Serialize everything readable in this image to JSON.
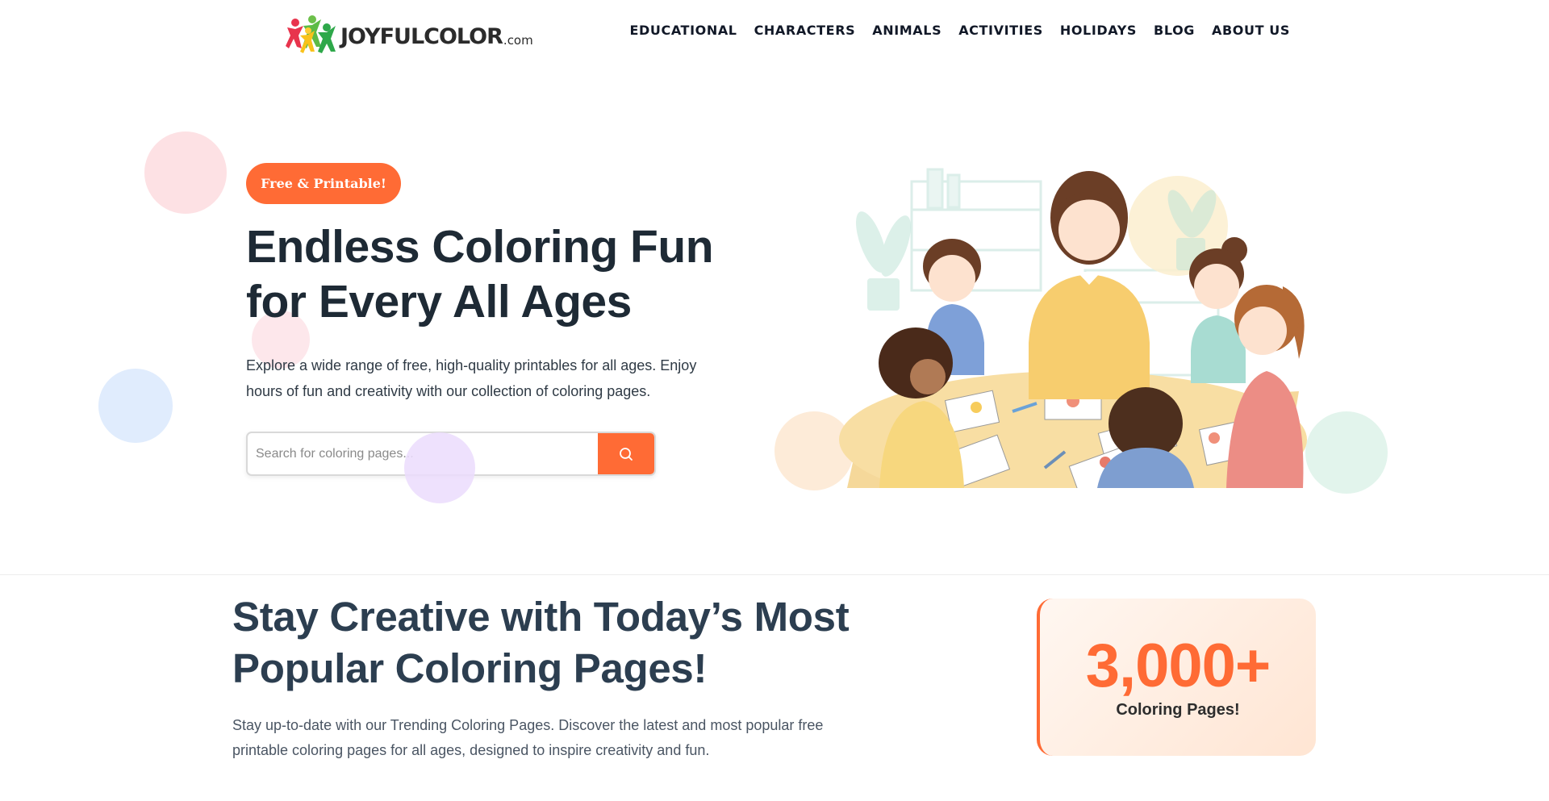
{
  "header": {
    "logo_text": "JOYFULCOLOR",
    "logo_tld": ".com",
    "nav": [
      "EDUCATIONAL",
      "CHARACTERS",
      "ANIMALS",
      "ACTIVITIES",
      "HOLIDAYS",
      "BLOG",
      "ABOUT US"
    ]
  },
  "hero": {
    "badge": "Free & Printable!",
    "title": "Endless Coloring Fun for Every All Ages",
    "description": "Explore a wide range of free, high-quality printables for all ages. Enjoy hours of fun and creativity with our collection of coloring pages.",
    "search_placeholder": "Search for coloring pages...",
    "search_icon": "search-icon"
  },
  "popular": {
    "title": "Stay Creative with Today’s Most Popular Coloring Pages!",
    "description": "Stay up-to-date with our Trending Coloring Pages. Discover the latest and most popular free printable coloring pages for all ages, designed to inspire creativity and fun.",
    "stat_number": "3,000+",
    "stat_label": "Coloring Pages!"
  },
  "colors": {
    "accent": "#ff6b35",
    "heading": "#1e2a35",
    "text": "#2f3a45"
  }
}
